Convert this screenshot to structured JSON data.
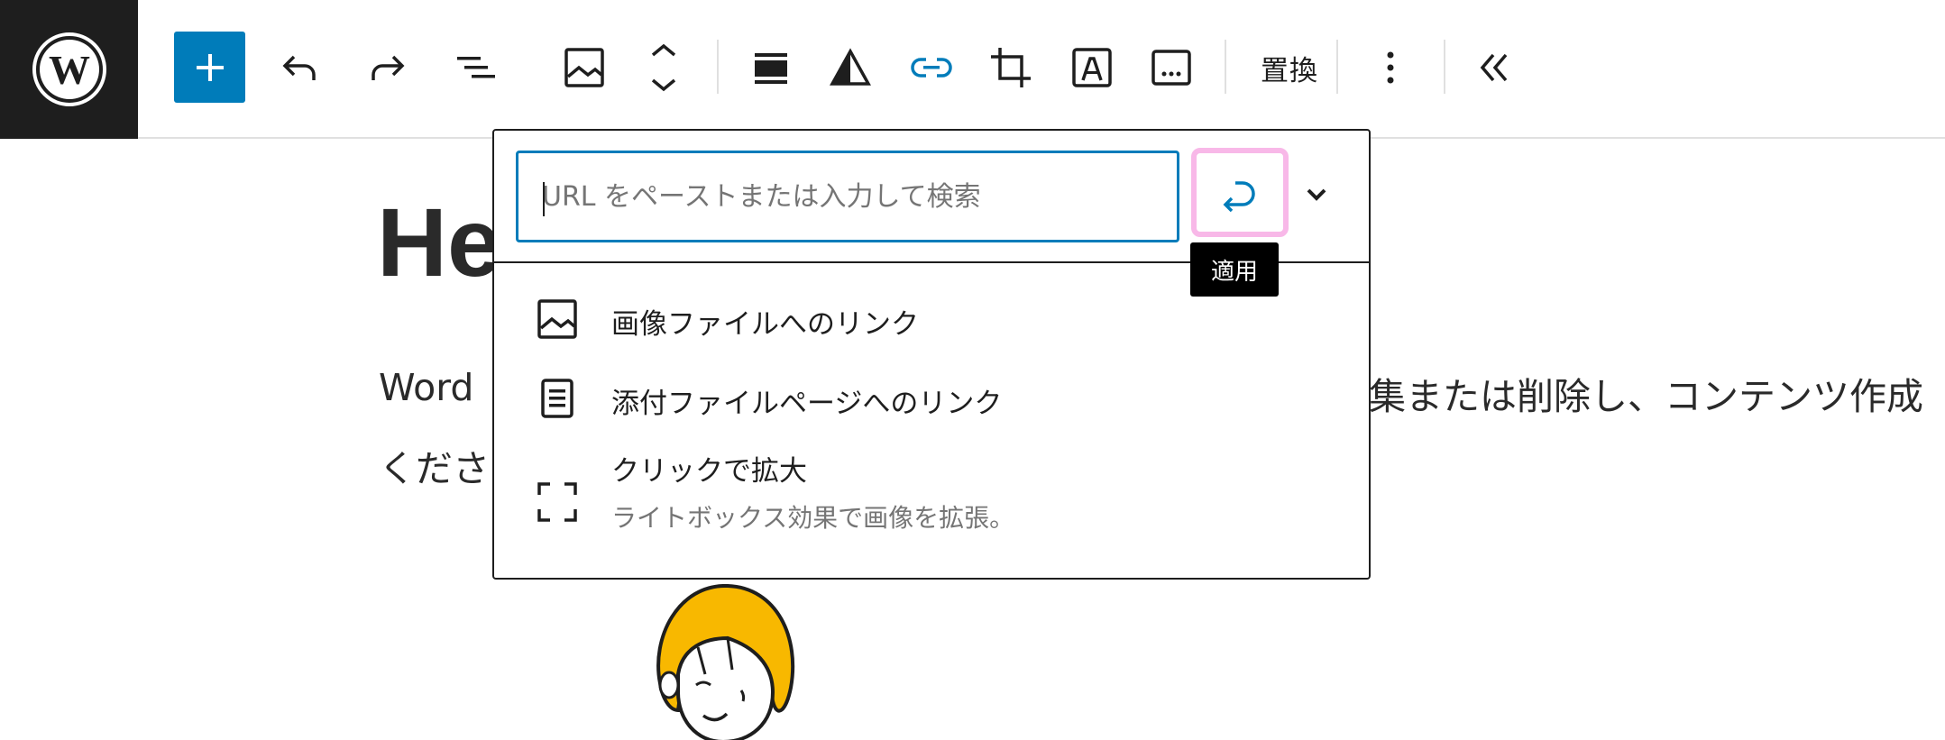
{
  "toolbar": {
    "replace_label": "置換",
    "colors": {
      "accent": "#007cba",
      "logo_bg": "#1e1e1e"
    },
    "icons": [
      "wordpress-logo-icon",
      "plus-icon",
      "undo-icon",
      "redo-icon",
      "list-view-icon",
      "image-icon",
      "move-arrows-icon",
      "align-icon",
      "duotone-icon",
      "link-icon",
      "crop-icon",
      "text-overlay-icon",
      "alt-text-icon",
      "more-vertical-icon",
      "collapse-chevrons-icon"
    ]
  },
  "content": {
    "title": "He",
    "para_line1_left": "Word",
    "para_line1_right": "集または削除し、コンテンツ作成",
    "para_line2_left": "くださ"
  },
  "link_popover": {
    "search": {
      "value": "",
      "placeholder": "URL をペーストまたは入力して検索"
    },
    "apply_tooltip": "適用",
    "highlight_color": "#f8b8e8",
    "options": [
      {
        "label": "画像ファイルへのリンク",
        "icon": "image-icon"
      },
      {
        "label": "添付ファイルページへのリンク",
        "icon": "page-icon"
      },
      {
        "label": "クリックで拡大",
        "description": "ライトボックス効果で画像を拡張。",
        "icon": "fullscreen-icon"
      }
    ]
  }
}
